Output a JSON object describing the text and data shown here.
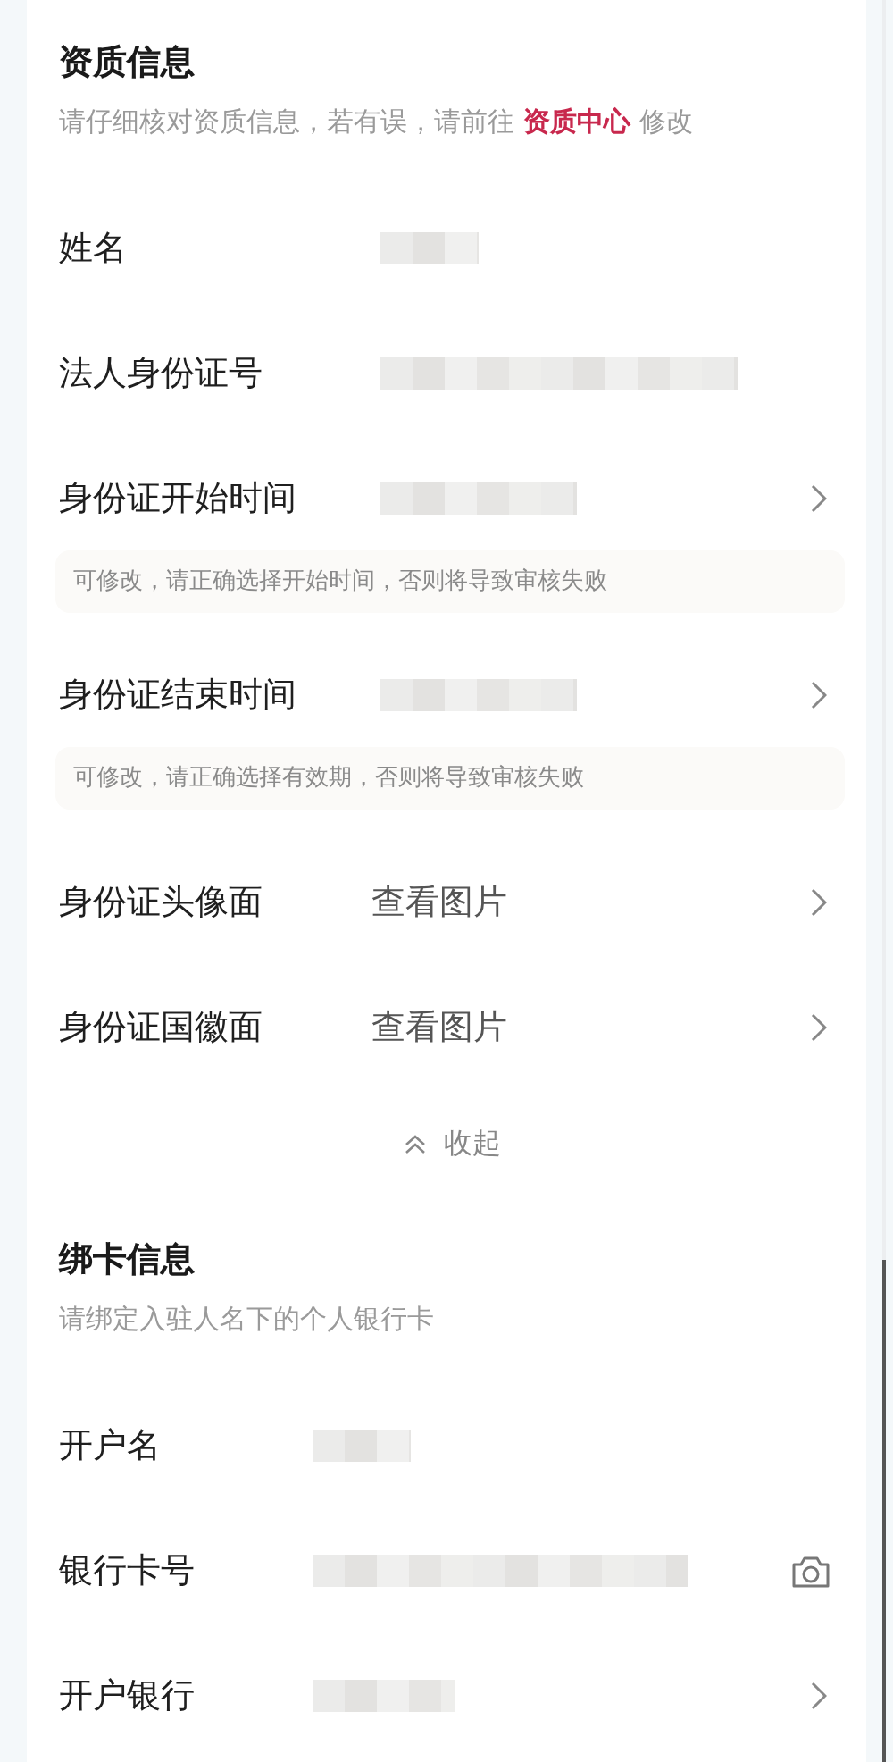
{
  "sections": [
    {
      "title": "资质信息",
      "subtitle": "请仔细核对资质信息，若有误，请前往",
      "link": "资质中心",
      "subtitle_end": "修改",
      "rows": [
        {
          "label": "姓名",
          "kind": "name"
        },
        {
          "label": "法人身份证号",
          "kind": "idnumber"
        },
        {
          "label": "身份证开始时间",
          "kind": "date",
          "chevron": true,
          "hint": "可修改，请正确选择开始时间，否则将导致审核失败"
        },
        {
          "label": "身份证结束时间",
          "kind": "date",
          "chevron": true,
          "hint": "可修改，请正确选择有效期，否则将导致审核失败"
        },
        {
          "label": "身份证头像面",
          "kind": "link",
          "value": "查看图片",
          "chevron": true
        },
        {
          "label": "身份证国徽面",
          "kind": "link",
          "value": "查看图片",
          "chevron": true
        }
      ],
      "collapse": "收起"
    },
    {
      "title": "绑卡信息",
      "subtitle": "请绑定入驻人名下的个人银行卡",
      "rows": [
        {
          "label": "开户名",
          "kind": "name"
        },
        {
          "label": "银行卡号",
          "kind": "cardnumber",
          "camera": true
        },
        {
          "label": "开户银行",
          "kind": "bank",
          "chevron": true
        }
      ]
    }
  ]
}
